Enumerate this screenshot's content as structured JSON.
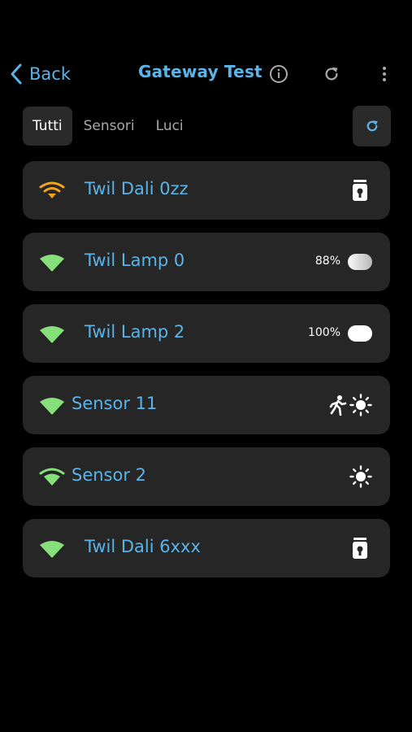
{
  "header": {
    "back_label": "Back",
    "title": "Gateway Test",
    "icons": [
      "chevron-left-icon",
      "info-icon",
      "refresh-icon",
      "more-vertical-icon"
    ]
  },
  "tabs": [
    {
      "label": "Tutti",
      "active": true
    },
    {
      "label": "Sensori",
      "active": false
    },
    {
      "label": "Luci",
      "active": false
    }
  ],
  "devices": [
    {
      "name": "Twil Dali 0zz",
      "signal": "weak",
      "signal_color": "#f3a320",
      "icon": "dali-device-icon"
    },
    {
      "name": "Twil Lamp 0",
      "signal": "full",
      "signal_color": "#86e07a",
      "brightness_label": "88%",
      "brightness": 88
    },
    {
      "name": "Twil Lamp 2",
      "signal": "full",
      "signal_color": "#86e07a",
      "brightness_label": "100%",
      "brightness": 100
    },
    {
      "name": "Sensor 11",
      "signal": "full",
      "signal_color": "#86e07a",
      "icons": [
        "motion-icon",
        "sun-icon"
      ]
    },
    {
      "name": "Sensor 2",
      "signal": "medium",
      "signal_color": "#86e07a",
      "icons": [
        "sun-icon"
      ]
    },
    {
      "name": "Twil Dali 6xxx",
      "signal": "full",
      "signal_color": "#86e07a",
      "icon": "dali-device-icon"
    }
  ],
  "colors": {
    "accent": "#5ab4e8",
    "card_bg": "#262626",
    "background": "#000000"
  }
}
